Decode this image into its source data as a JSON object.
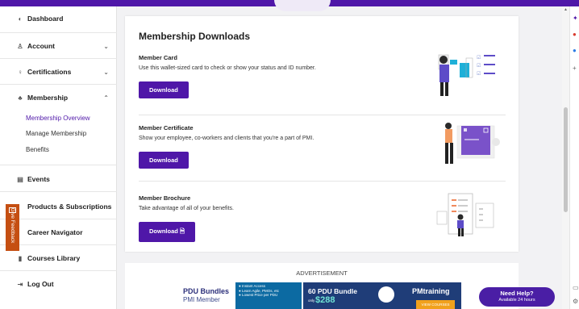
{
  "sidebar": {
    "dashboard": "Dashboard",
    "account": "Account",
    "certifications": "Certifications",
    "membership": "Membership",
    "membership_sub": [
      "Membership Overview",
      "Manage Membership",
      "Benefits"
    ],
    "events": "Events",
    "products": "Products & Subscriptions",
    "career": "Career Navigator",
    "courses": "Courses Library",
    "logout": "Log Out",
    "feedback": "Give Feedback"
  },
  "main": {
    "title": "Membership Downloads",
    "sections": [
      {
        "title": "Member Card",
        "desc": "Use this wallet-sized card to check or show your status and ID number.",
        "button": "Download"
      },
      {
        "title": "Member Certificate",
        "desc": "Show your employee, co-workers and clients that you're a part of PMI.",
        "button": "Download"
      },
      {
        "title": "Member Brochure",
        "desc": "Take advantage of all of your benefits.",
        "button": "Download"
      }
    ]
  },
  "ad": {
    "label": "ADVERTISEMENT",
    "bundle_title": "PDU Bundles",
    "bundle_sub": "PMI Member",
    "bullets": [
      "Instant Access",
      "Learn Agile, PMOs, etc",
      "Lowest Price per PDU"
    ],
    "headline": "60 PDU Bundle",
    "only": "only",
    "price": "$288",
    "brand": "PMtraining",
    "cta": "VIEW COURSES"
  },
  "help": {
    "title": "Need Help?",
    "sub": "Available 24 hours"
  },
  "colors": {
    "brand": "#4f17a8",
    "feedback": "#c54f12"
  }
}
